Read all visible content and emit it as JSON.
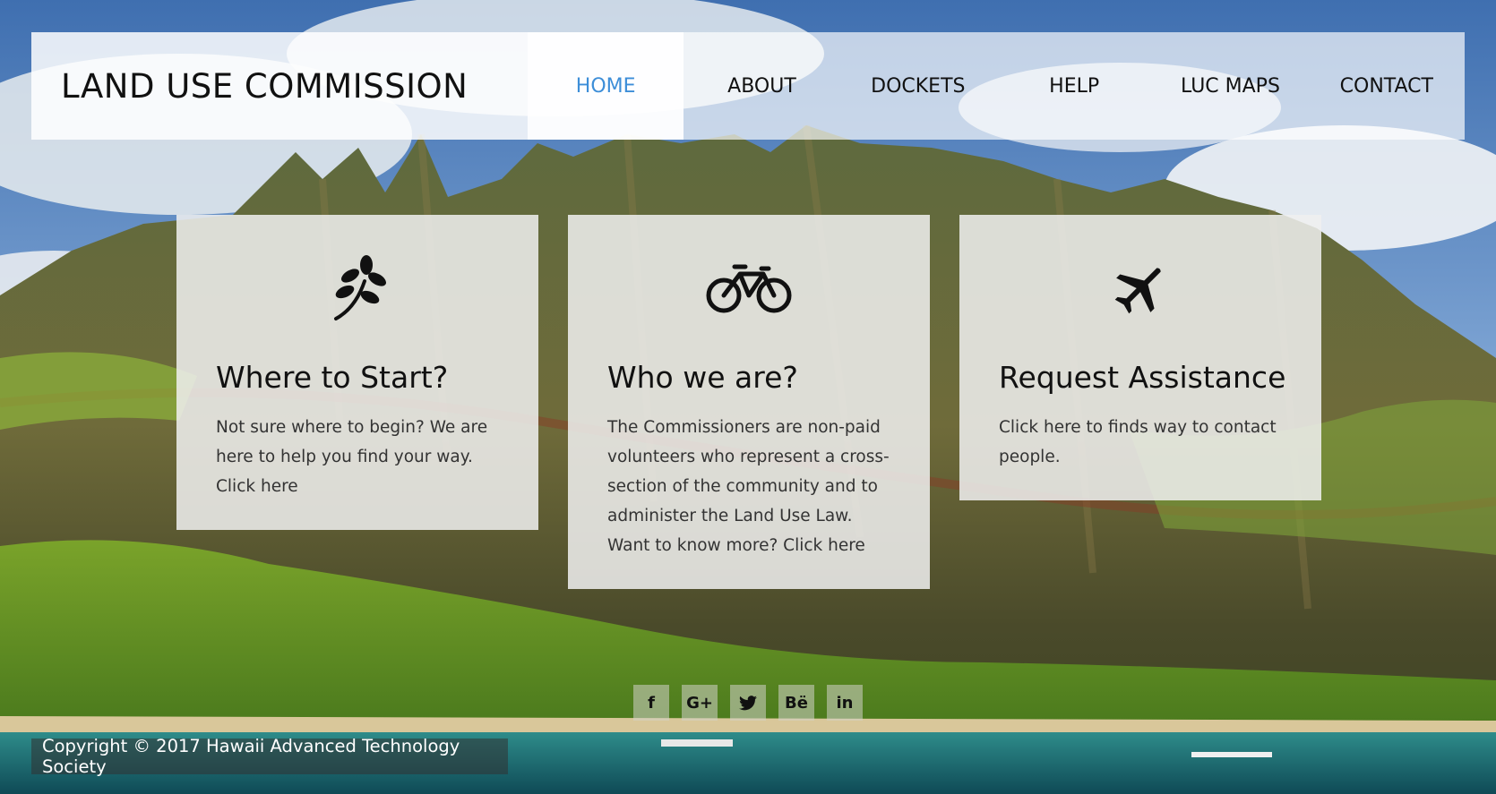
{
  "header": {
    "brand": "LAND USE COMMISSION",
    "nav": [
      {
        "label": "HOME",
        "active": true
      },
      {
        "label": "ABOUT"
      },
      {
        "label": "DOCKETS"
      },
      {
        "label": "HELP"
      },
      {
        "label": "LUC MAPS"
      },
      {
        "label": "CONTACT"
      }
    ]
  },
  "cards": [
    {
      "icon": "leaf-icon",
      "title": "Where to Start?",
      "text": "Not sure where to begin? We are here to help you find your way. Click here"
    },
    {
      "icon": "bicycle-icon",
      "title": "Who we are?",
      "text": "The Commissioners are non-paid volunteers who represent a cross-section of the community and to administer the Land Use Law. Want to know more? Click here"
    },
    {
      "icon": "airplane-icon",
      "title": "Request Assistance",
      "text": "Click here to finds way to contact people."
    }
  ],
  "social": [
    {
      "icon": "facebook-icon",
      "glyph": "f"
    },
    {
      "icon": "google-plus-icon",
      "glyph": "G+"
    },
    {
      "icon": "twitter-icon",
      "glyph": "✈"
    },
    {
      "icon": "behance-icon",
      "glyph": "Bë"
    },
    {
      "icon": "linkedin-icon",
      "glyph": "in"
    }
  ],
  "footer": {
    "copyright": "Copyright © 2017 Hawaii Advanced Technology Society"
  },
  "colors": {
    "accent": "#3d8ed8",
    "text": "#111111"
  }
}
